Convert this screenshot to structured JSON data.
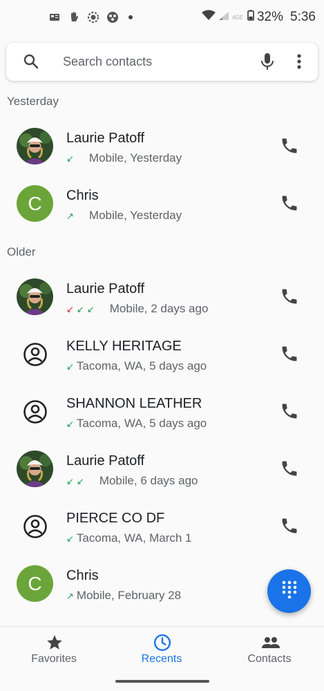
{
  "status": {
    "battery": "32%",
    "time": "5:36",
    "network": "4GE"
  },
  "search": {
    "placeholder": "Search contacts"
  },
  "sections": {
    "yesterday": "Yesterday",
    "older": "Older"
  },
  "calls": [
    {
      "name": "Laurie Patoff",
      "detail": "Mobile, Yesterday",
      "avatar": "photo",
      "arrows": [
        "incoming"
      ]
    },
    {
      "name": "Chris",
      "detail": "Mobile, Yesterday",
      "avatar": "C",
      "arrows": [
        "outgoing"
      ]
    },
    {
      "name": "Laurie Patoff",
      "detail": "Mobile, 2 days ago",
      "avatar": "photo",
      "arrows": [
        "missed",
        "incoming",
        "incoming"
      ]
    },
    {
      "name": "KELLY HERITAGE",
      "detail": "Tacoma, WA, 5 days ago",
      "avatar": "generic",
      "arrows": [
        "incoming"
      ]
    },
    {
      "name": "SHANNON LEATHER",
      "detail": "Tacoma, WA, 5 days ago",
      "avatar": "generic",
      "arrows": [
        "incoming"
      ]
    },
    {
      "name": "Laurie Patoff",
      "detail": "Mobile, 6 days ago",
      "avatar": "photo",
      "arrows": [
        "incoming",
        "incoming"
      ]
    },
    {
      "name": "PIERCE CO DF",
      "detail": "Tacoma, WA, March 1",
      "avatar": "generic",
      "arrows": [
        "incoming"
      ]
    },
    {
      "name": "Chris",
      "detail": "Mobile, February 28",
      "avatar": "C",
      "arrows": [
        "outgoing"
      ]
    }
  ],
  "nav": {
    "favorites": "Favorites",
    "recents": "Recents",
    "contacts": "Contacts"
  },
  "colors": {
    "accent": "#1a73e8",
    "avatar_green": "#6ba539",
    "call_arrow": "#1e9e57",
    "missed": "#d93025"
  }
}
